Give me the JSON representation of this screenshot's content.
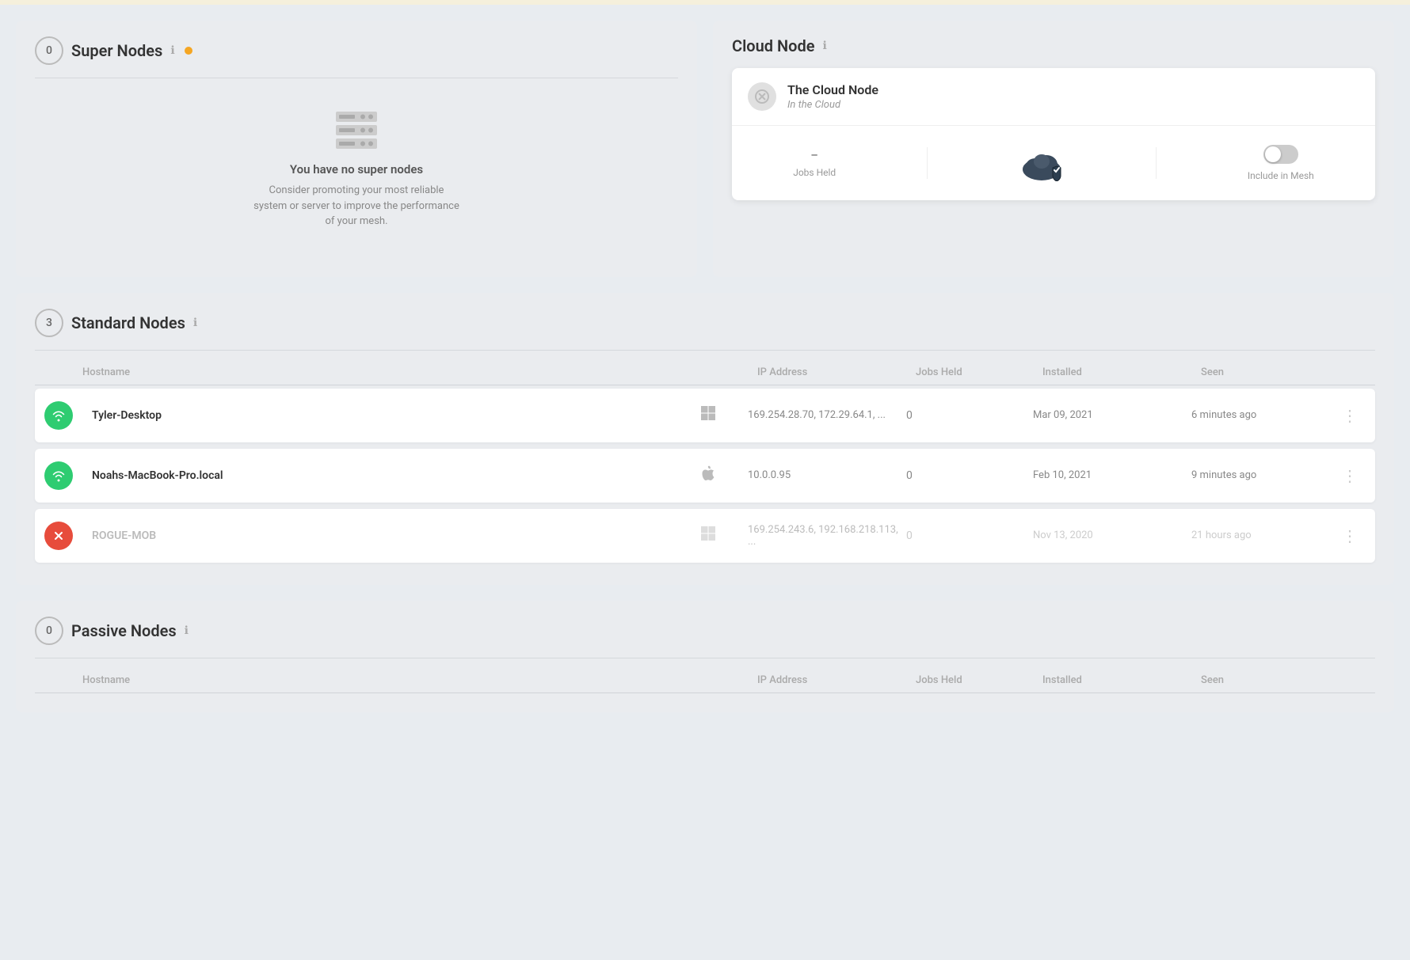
{
  "topBar": {
    "color": "#f5f0dc"
  },
  "superNodes": {
    "title": "Super Nodes",
    "count": "0",
    "infoIcon": "ℹ",
    "hasNotification": true,
    "emptyState": {
      "title": "You have no super nodes",
      "description": "Consider promoting your most reliable system or server to improve the performance of your mesh."
    }
  },
  "cloudNode": {
    "title": "Cloud Node",
    "infoIcon": "ℹ",
    "card": {
      "name": "The Cloud Node",
      "subtitle": "In the Cloud",
      "jobsHeld": "–",
      "jobsHeldLabel": "Jobs Held",
      "includeInMeshLabel": "Include in Mesh",
      "toggleEnabled": false
    }
  },
  "standardNodes": {
    "title": "Standard Nodes",
    "count": "3",
    "infoIcon": "ℹ",
    "columns": {
      "hostname": "Hostname",
      "ipAddress": "IP Address",
      "jobsHeld": "Jobs Held",
      "installed": "Installed",
      "seen": "Seen"
    },
    "rows": [
      {
        "id": "tyler",
        "name": "Tyler-Desktop",
        "status": "green",
        "os": "windows",
        "ipAddress": "169.254.28.70, 172.29.64.1, ...",
        "jobsHeld": "0",
        "installed": "Mar 09, 2021",
        "seen": "6 minutes ago",
        "faded": false
      },
      {
        "id": "noahs",
        "name": "Noahs-MacBook-Pro.local",
        "status": "green",
        "os": "apple",
        "ipAddress": "10.0.0.95",
        "jobsHeld": "0",
        "installed": "Feb 10, 2021",
        "seen": "9 minutes ago",
        "faded": false
      },
      {
        "id": "rogue",
        "name": "ROGUE-MOB",
        "status": "red",
        "os": "windows",
        "ipAddress": "169.254.243.6, 192.168.218.113, ...",
        "jobsHeld": "0",
        "installed": "Nov 13, 2020",
        "seen": "21 hours ago",
        "faded": true
      }
    ]
  },
  "passiveNodes": {
    "title": "Passive Nodes",
    "count": "0",
    "infoIcon": "ℹ",
    "columns": {
      "hostname": "Hostname",
      "ipAddress": "IP Address",
      "jobsHeld": "Jobs Held",
      "installed": "Installed",
      "seen": "Seen"
    }
  }
}
